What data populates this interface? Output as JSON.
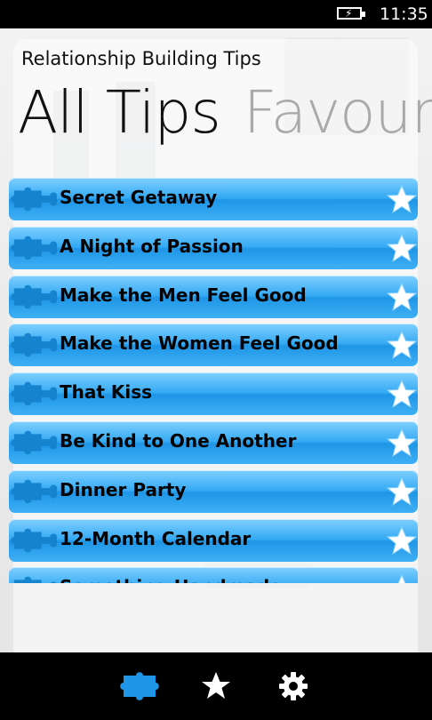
{
  "status_bar": {
    "time": "11:35",
    "battery_icon": "battery-charging-icon"
  },
  "app": {
    "title": "Relationship Building Tips"
  },
  "pivot": {
    "tabs": [
      {
        "label": "All Tips"
      },
      {
        "label": "Favouri"
      }
    ]
  },
  "tips": [
    {
      "label": "Secret Getaway"
    },
    {
      "label": "A Night of Passion"
    },
    {
      "label": "Make the Men Feel Good"
    },
    {
      "label": "Make the Women Feel Good"
    },
    {
      "label": "That Kiss"
    },
    {
      "label": "Be Kind to One Another"
    },
    {
      "label": "Dinner Party"
    },
    {
      "label": "12-Month Calendar"
    },
    {
      "label": "Something Handmade"
    }
  ],
  "app_bar": {
    "buttons": [
      "puzzle-icon",
      "star-icon",
      "gear-icon"
    ]
  },
  "colors": {
    "accent": "#1e95e6",
    "tile_light": "#7fd0ff",
    "star": "#ffffff"
  }
}
